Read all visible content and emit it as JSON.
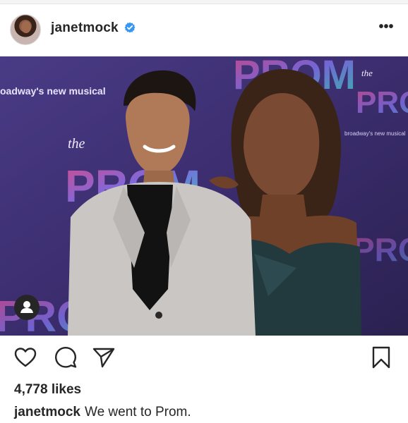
{
  "post": {
    "username": "janetmock",
    "verified": true,
    "more_label": "•••",
    "photo": {
      "backdrop_texts": [
        "oadway's new musical",
        "the",
        "PROM",
        "broadway's new musical",
        "the",
        "PROM"
      ]
    },
    "likes_text": "4,778 likes",
    "caption": {
      "username": "janetmock",
      "text": "We went to Prom."
    }
  },
  "icons": {
    "verified": "verified-badge-icon",
    "more": "more-options-icon",
    "like": "heart-icon",
    "comment": "comment-icon",
    "share": "send-icon",
    "save": "bookmark-icon",
    "user_tag": "user-tag-icon"
  },
  "colors": {
    "text": "#262626",
    "verified_blue": "#3897f0",
    "backdrop_purple": "#3d2f73"
  }
}
